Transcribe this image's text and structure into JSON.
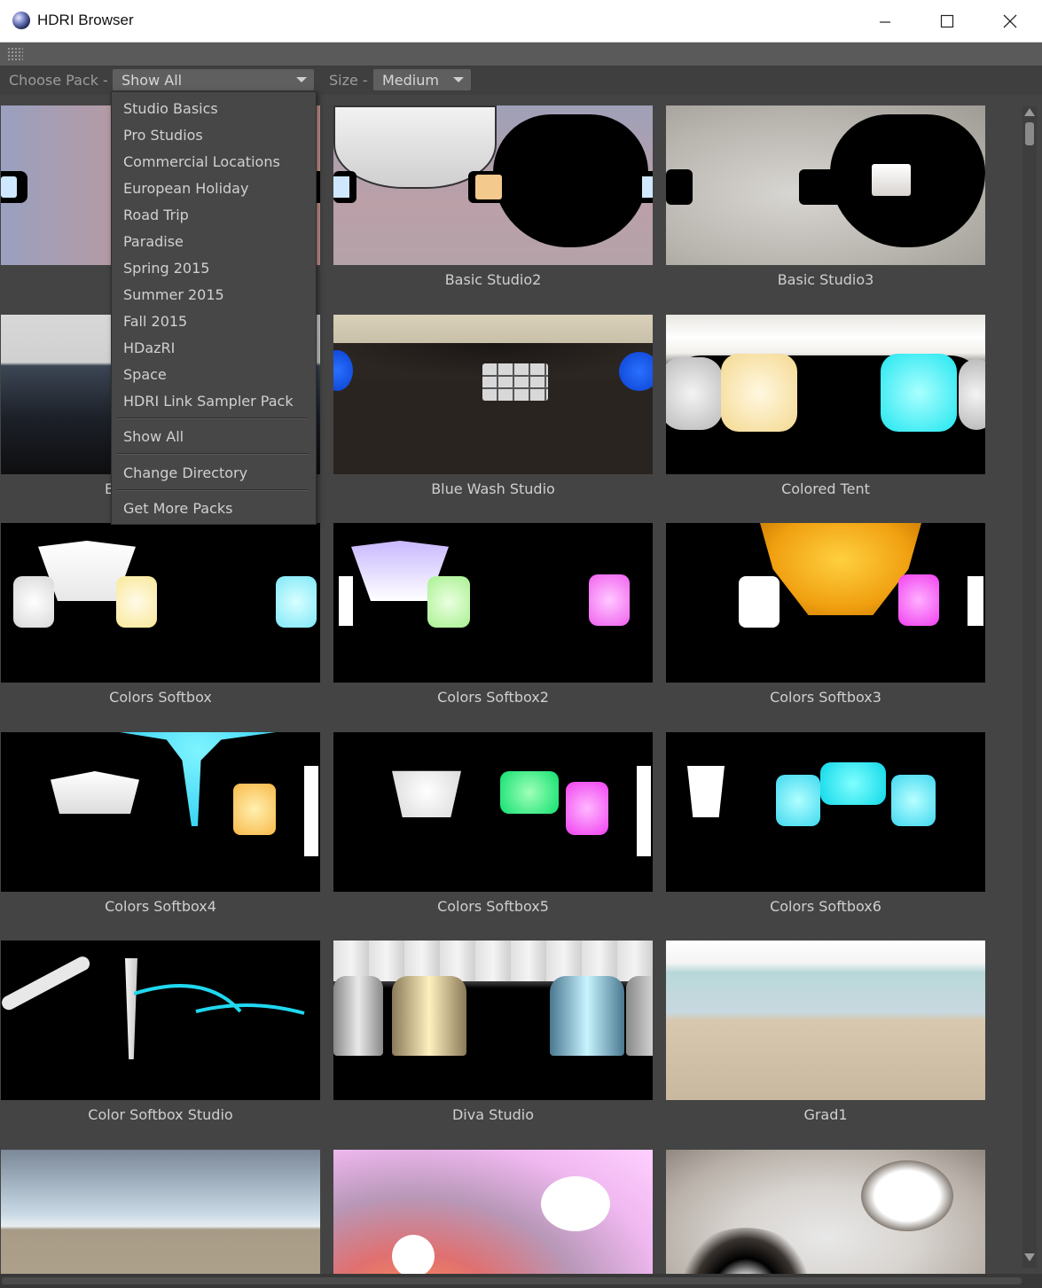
{
  "window": {
    "title": "HDRI Browser"
  },
  "toolbar": {
    "pack_label": "Choose Pack -",
    "pack_value": "Show All",
    "size_label": "Size -",
    "size_value": "Medium"
  },
  "pack_menu": {
    "items": [
      "Studio Basics",
      "Pro Studios",
      "Commercial Locations",
      "European Holiday",
      "Road Trip",
      "Paradise",
      "Spring 2015",
      "Summer 2015",
      "Fall 2015",
      "HDazRI",
      "Space",
      "HDRI Link Sampler Pack"
    ],
    "show_all": "Show All",
    "change_directory": "Change Directory",
    "get_more": "Get More Packs"
  },
  "thumbnails": {
    "row1": [
      "",
      "Basic Studio2",
      "Basic Studio3"
    ],
    "row2": [
      "B",
      "Blue Wash Studio",
      "Colored Tent"
    ],
    "row3": [
      "Colors Softbox",
      "Colors Softbox2",
      "Colors Softbox3"
    ],
    "row4": [
      "Colors Softbox4",
      "Colors Softbox5",
      "Colors Softbox6"
    ],
    "row5": [
      "Color Softbox Studio",
      "Diva Studio",
      "Grad1"
    ]
  }
}
